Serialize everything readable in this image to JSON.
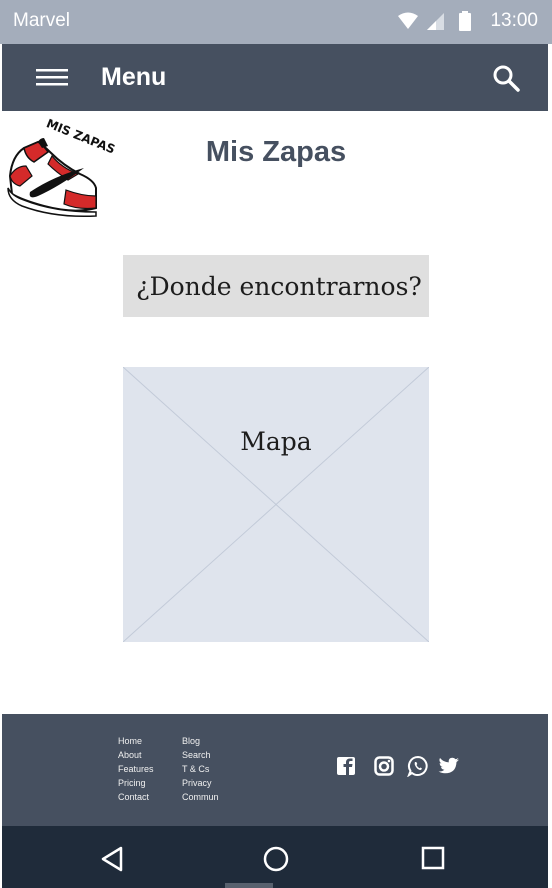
{
  "status_bar": {
    "carrier": "Marvel",
    "time": "13:00",
    "icons": [
      "wifi-icon",
      "signal-icon",
      "battery-icon"
    ]
  },
  "app_bar": {
    "title": "Menu",
    "icons": [
      "hamburger-menu-icon",
      "search-icon"
    ]
  },
  "header": {
    "logo_text": "MIS ZAPAS",
    "title": "Mis Zapas"
  },
  "main": {
    "find_us_button": "¿Donde encontrarnos?",
    "map_label": "Mapa"
  },
  "footer": {
    "links_col1": [
      "Home",
      "About",
      "Features",
      "Pricing",
      "Contact"
    ],
    "links_col2": [
      "Blog",
      "Search",
      "T & Cs",
      "Privacy",
      "Commun"
    ],
    "social_icons": [
      "facebook-icon",
      "instagram-icon",
      "whatsapp-icon",
      "twitter-icon"
    ]
  },
  "nav_bar": {
    "icons": [
      "back-icon",
      "home-icon",
      "recents-icon"
    ]
  },
  "colors": {
    "status_bar": "#a4adbb",
    "app_bar": "#465060",
    "footer": "#465060",
    "nav_bar": "#1f2b3a",
    "button_bg": "#dfdfdf",
    "map_bg": "#dfe4ed"
  }
}
